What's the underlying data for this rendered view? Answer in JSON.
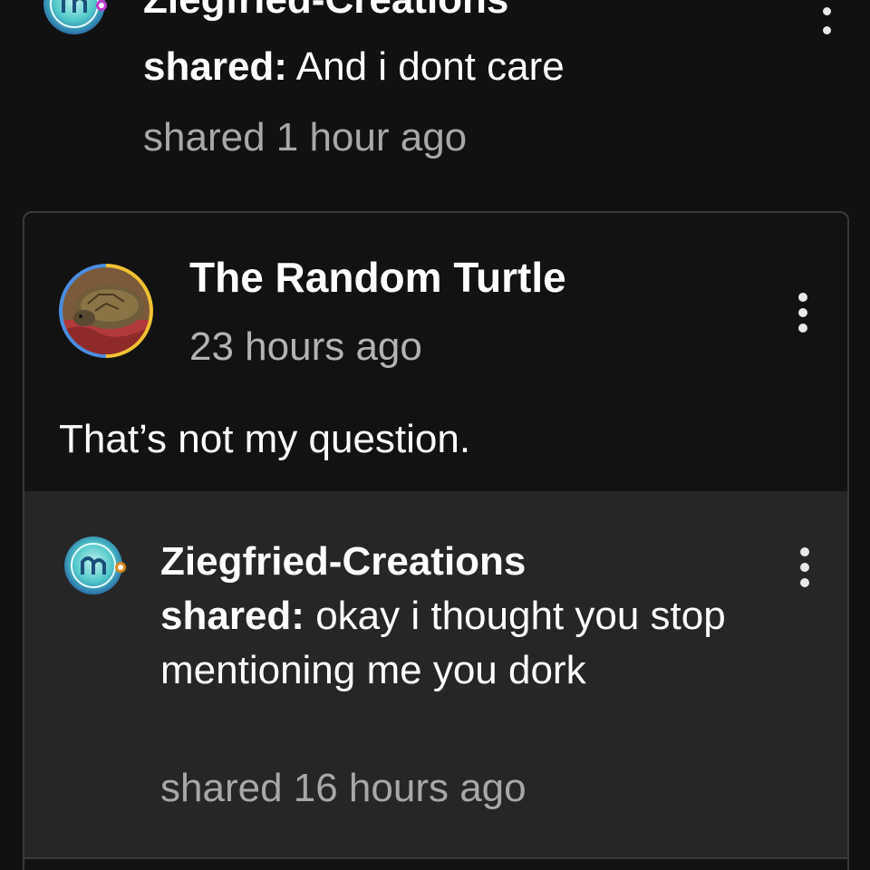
{
  "top_share": {
    "author": "Ziegfried-Creations",
    "shared_label": "shared:",
    "message": "And i dont care",
    "time": "shared 1 hour ago",
    "avatar_icon": "ziegfried-logo-icon"
  },
  "post": {
    "author": "The Random Turtle",
    "time": "23 hours ago",
    "body": "That’s not my question.",
    "avatar_icon": "turtle-photo-avatar"
  },
  "reply": {
    "author": "Ziegfried-Creations",
    "shared_label": "shared:",
    "message": "okay i thought you stop mentioning me you dork",
    "time": "shared 16 hours ago",
    "avatar_icon": "ziegfried-logo-icon"
  },
  "colors": {
    "background": "#111111",
    "card_border": "#3a3a3a",
    "reply_background": "#262626",
    "secondary_text": "#a8a8a8"
  }
}
